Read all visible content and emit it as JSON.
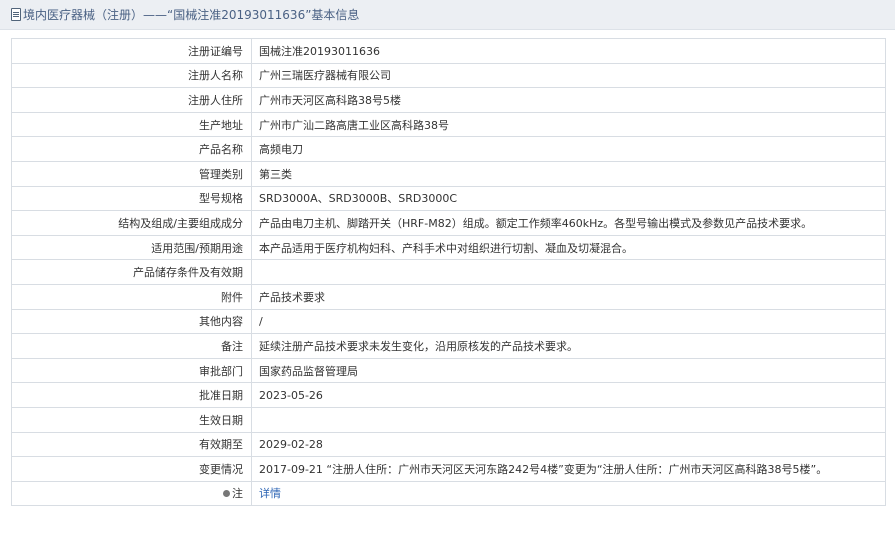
{
  "header": {
    "title": "境内医疗器械（注册）——“国械注准20193011636”基本信息"
  },
  "fields": [
    {
      "label": "注册证编号",
      "value": "国械注准20193011636"
    },
    {
      "label": "注册人名称",
      "value": "广州三瑞医疗器械有限公司"
    },
    {
      "label": "注册人住所",
      "value": "广州市天河区高科路38号5楼"
    },
    {
      "label": "生产地址",
      "value": "广州市广汕二路高唐工业区高科路38号"
    },
    {
      "label": "产品名称",
      "value": "高频电刀"
    },
    {
      "label": "管理类别",
      "value": "第三类"
    },
    {
      "label": "型号规格",
      "value": "SRD3000A、SRD3000B、SRD3000C"
    },
    {
      "label": "结构及组成/主要组成成分",
      "value": "产品由电刀主机、脚踏开关（HRF-M82）组成。额定工作频率460kHz。各型号输出模式及参数见产品技术要求。"
    },
    {
      "label": "适用范围/预期用途",
      "value": "本产品适用于医疗机构妇科、产科手术中对组织进行切割、凝血及切凝混合。"
    },
    {
      "label": "产品储存条件及有效期",
      "value": ""
    },
    {
      "label": "附件",
      "value": "产品技术要求"
    },
    {
      "label": "其他内容",
      "value": "/"
    },
    {
      "label": "备注",
      "value": "延续注册产品技术要求未发生变化，沿用原核发的产品技术要求。"
    },
    {
      "label": "审批部门",
      "value": "国家药品监督管理局"
    },
    {
      "label": "批准日期",
      "value": "2023-05-26"
    },
    {
      "label": "生效日期",
      "value": ""
    },
    {
      "label": "有效期至",
      "value": "2029-02-28"
    },
    {
      "label": "变更情况",
      "value": "2017-09-21 “注册人住所：广州市天河区天河东路242号4楼”变更为“注册人住所：广州市天河区高科路38号5楼”。"
    }
  ],
  "note": {
    "icon": "pin-icon",
    "label": "注",
    "link_text": "详情"
  }
}
